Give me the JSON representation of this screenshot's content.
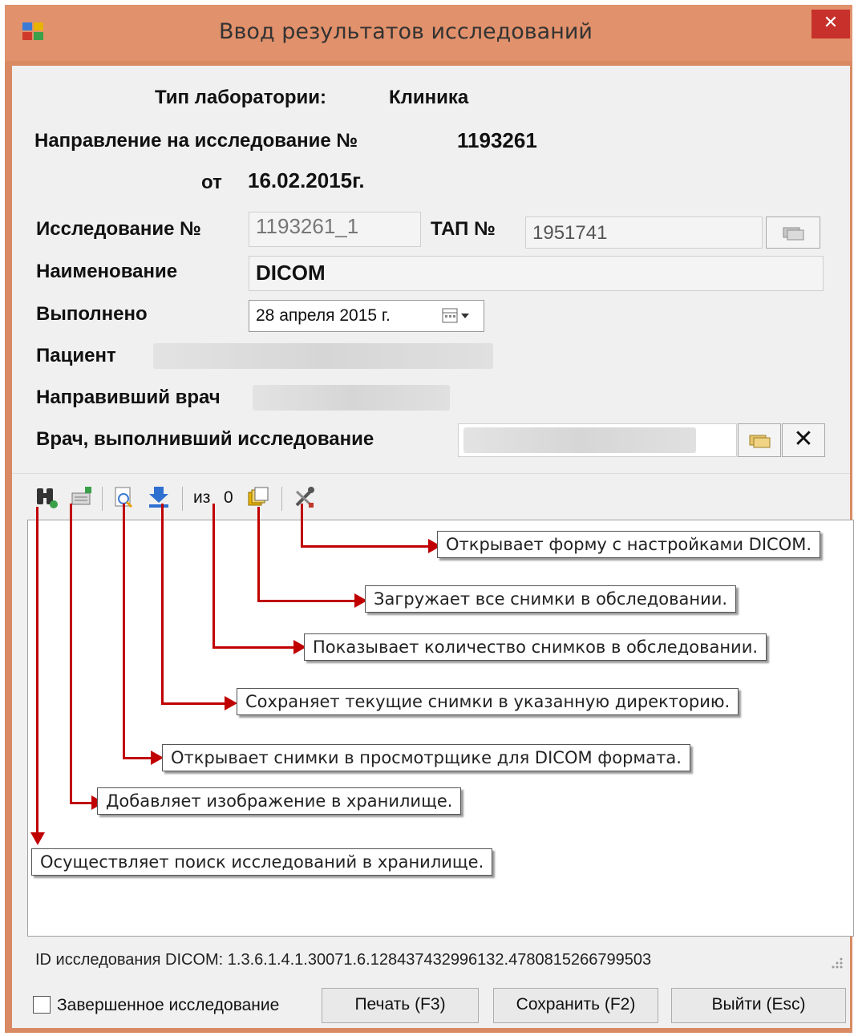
{
  "window": {
    "title": "Ввод результатов исследований",
    "close_glyph": "✕"
  },
  "form": {
    "lab_type_label": "Тип лаборатории:",
    "lab_type_value": "Клиника",
    "referral_label": "Направление на исследование №",
    "referral_number": "1193261",
    "from_label": "от",
    "from_date": "16.02.2015г.",
    "study_no_label": "Исследование №",
    "study_no_value": "1193261_1",
    "tap_label": "ТАП №",
    "tap_value": "1951741",
    "name_label": "Наименование",
    "name_value": "DICOM",
    "done_label": "Выполнено",
    "done_date": "28  апреля  2015 г.",
    "patient_label": "Пациент",
    "referring_doctor_label": "Направивший врач",
    "performing_doctor_label": "Врач, выполнивший исследование",
    "clear_glyph": "✕"
  },
  "toolbar": {
    "count_prefix": "из",
    "count_value": "0"
  },
  "callouts": {
    "settings": "Открывает форму с настройками DICOM.",
    "load_all": "Загружает все снимки в обследовании.",
    "count": "Показывает количество снимков в обследовании.",
    "save_dir": "Сохраняет текущие снимки в указанную директорию.",
    "viewer": "Открывает снимки в просмотрщике для DICOM формата.",
    "add_image": "Добавляет изображение в хранилище.",
    "search": "Осуществляет поиск исследований в хранилище."
  },
  "footer": {
    "dicom_id": "ID исследования DICOM: 1.3.6.1.4.1.30071.6.128437432996132.4780815266799503",
    "completed_label": "Завершенное исследование",
    "completed_checked": false,
    "print_button": "Печать (F3)",
    "save_button": "Сохранить (F2)",
    "exit_button": "Выйти (Esc)"
  },
  "colors": {
    "title_bar": "#e1916b",
    "close_button": "#c7302b",
    "annotation_arrows": "#c00000"
  }
}
